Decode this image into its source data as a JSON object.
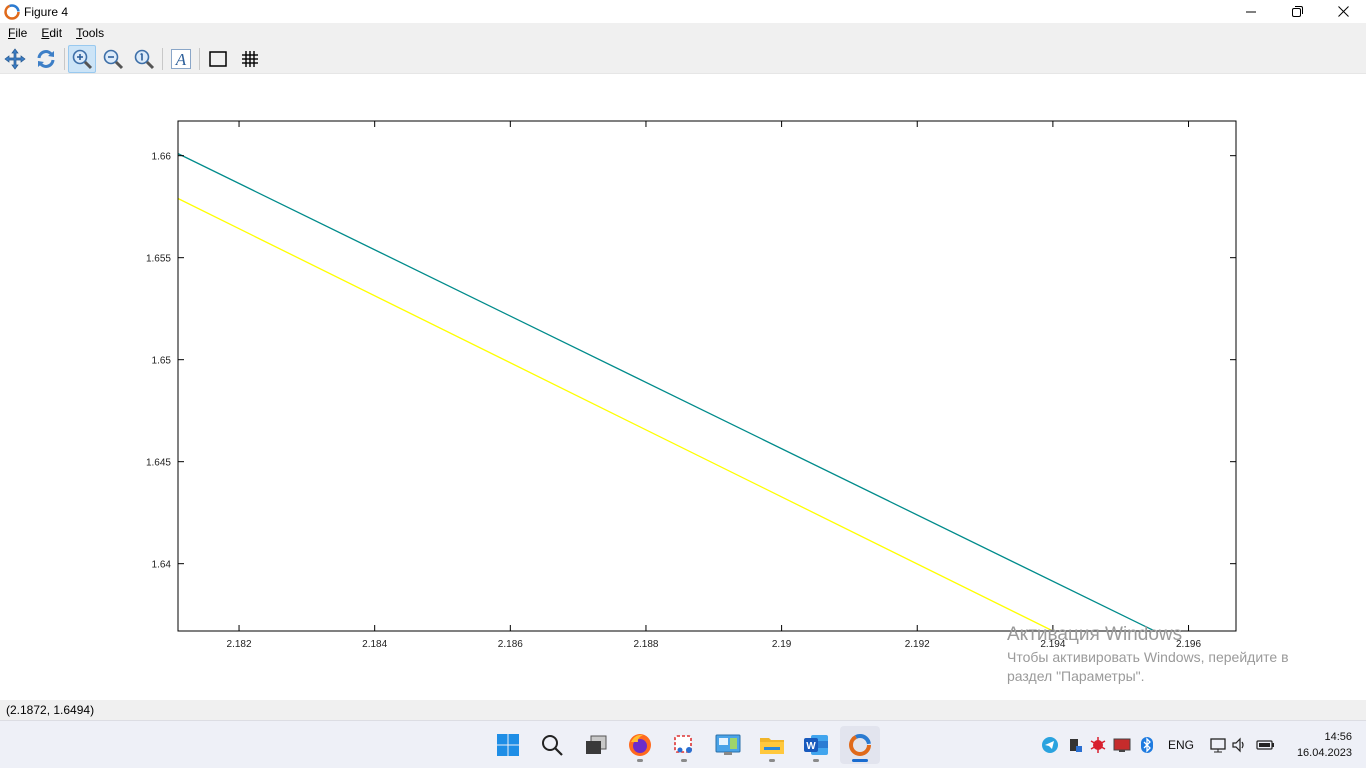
{
  "window": {
    "title": "Figure 4"
  },
  "menu": {
    "items": [
      {
        "accel": "F",
        "rest": "ile"
      },
      {
        "accel": "E",
        "rest": "dit"
      },
      {
        "accel": "T",
        "rest": "ools"
      }
    ]
  },
  "toolbar": {
    "buttons": [
      {
        "icon": "pan-icon"
      },
      {
        "icon": "rotate-icon"
      },
      {
        "icon": "zoom-in-icon",
        "active": true
      },
      {
        "icon": "zoom-out-icon"
      },
      {
        "icon": "zoom-reset-icon"
      },
      {
        "icon": "text-insert-icon"
      },
      {
        "icon": "axes-box-icon"
      },
      {
        "icon": "grid-icon"
      }
    ]
  },
  "chart_data": {
    "type": "line",
    "xlim": [
      2.1811,
      2.1967
    ],
    "ylim": [
      1.6367,
      1.6617
    ],
    "xticks": [
      "2.182",
      "2.184",
      "2.186",
      "2.188",
      "2.19",
      "2.192",
      "2.194",
      "2.196"
    ],
    "yticks": [
      "1.66",
      "1.655",
      "1.65",
      "1.645",
      "1.64"
    ],
    "grid": false,
    "series": [
      {
        "color": "#008b8b",
        "x": [
          2.1811,
          2.1955
        ],
        "y": [
          1.6601,
          1.6367
        ]
      },
      {
        "color": "#ffff00",
        "x": [
          2.1811,
          2.194
        ],
        "y": [
          1.6579,
          1.6367
        ]
      }
    ]
  },
  "status": {
    "coords": "(2.1872, 1.6494)"
  },
  "watermark": {
    "title": "Активация Windows",
    "line1": "Чтобы активировать Windows, перейдите в",
    "line2": "раздел \"Параметры\"."
  },
  "taskbar": {
    "apps": [
      "windows-start-icon",
      "search-icon",
      "task-view-icon",
      "firefox-icon",
      "snipping-tool-icon",
      "control-panel-icon",
      "file-explorer-icon",
      "word-icon",
      "octave-icon"
    ],
    "tray": {
      "lang": "ENG",
      "time": "14:56",
      "date": "16.04.2023"
    }
  }
}
